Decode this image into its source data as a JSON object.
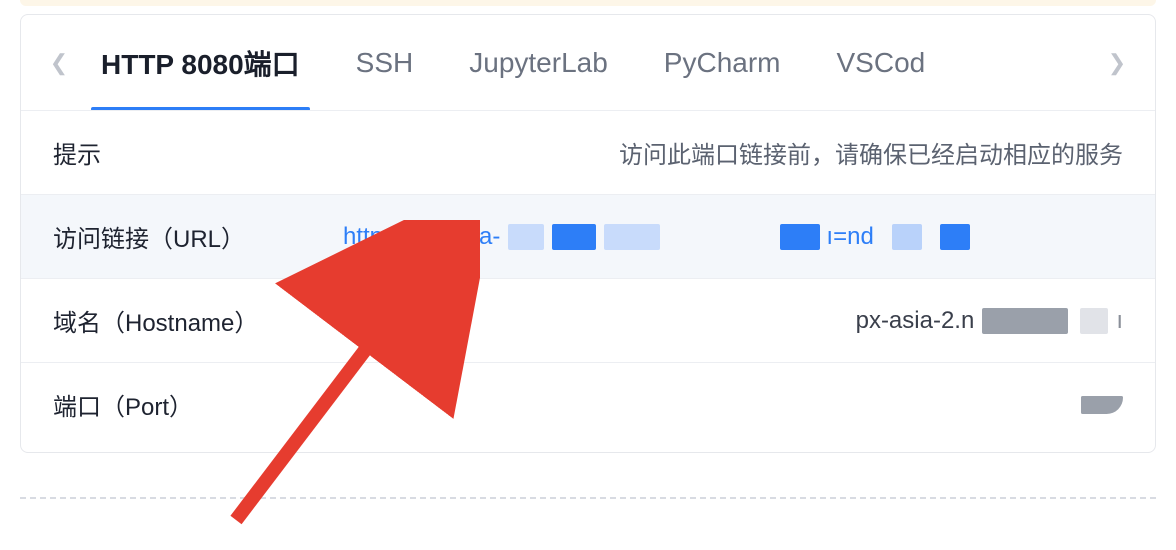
{
  "tabs": {
    "items": [
      {
        "label": "HTTP 8080端口",
        "active": true
      },
      {
        "label": "SSH",
        "active": false
      },
      {
        "label": "JupyterLab",
        "active": false
      },
      {
        "label": "PyCharm",
        "active": false
      },
      {
        "label": "VSCod",
        "active": false
      }
    ]
  },
  "rows": {
    "tip": {
      "label": "提示",
      "value": "访问此端口链接前，请确保已经启动相应的服务"
    },
    "url": {
      "label": "访问链接（URL）",
      "prefix": "https://px-asia-",
      "fragment": "ı=nd"
    },
    "hostname": {
      "label": "域名（Hostname）",
      "prefix": "px-asia-2.n"
    },
    "port": {
      "label": "端口（Port）"
    }
  }
}
